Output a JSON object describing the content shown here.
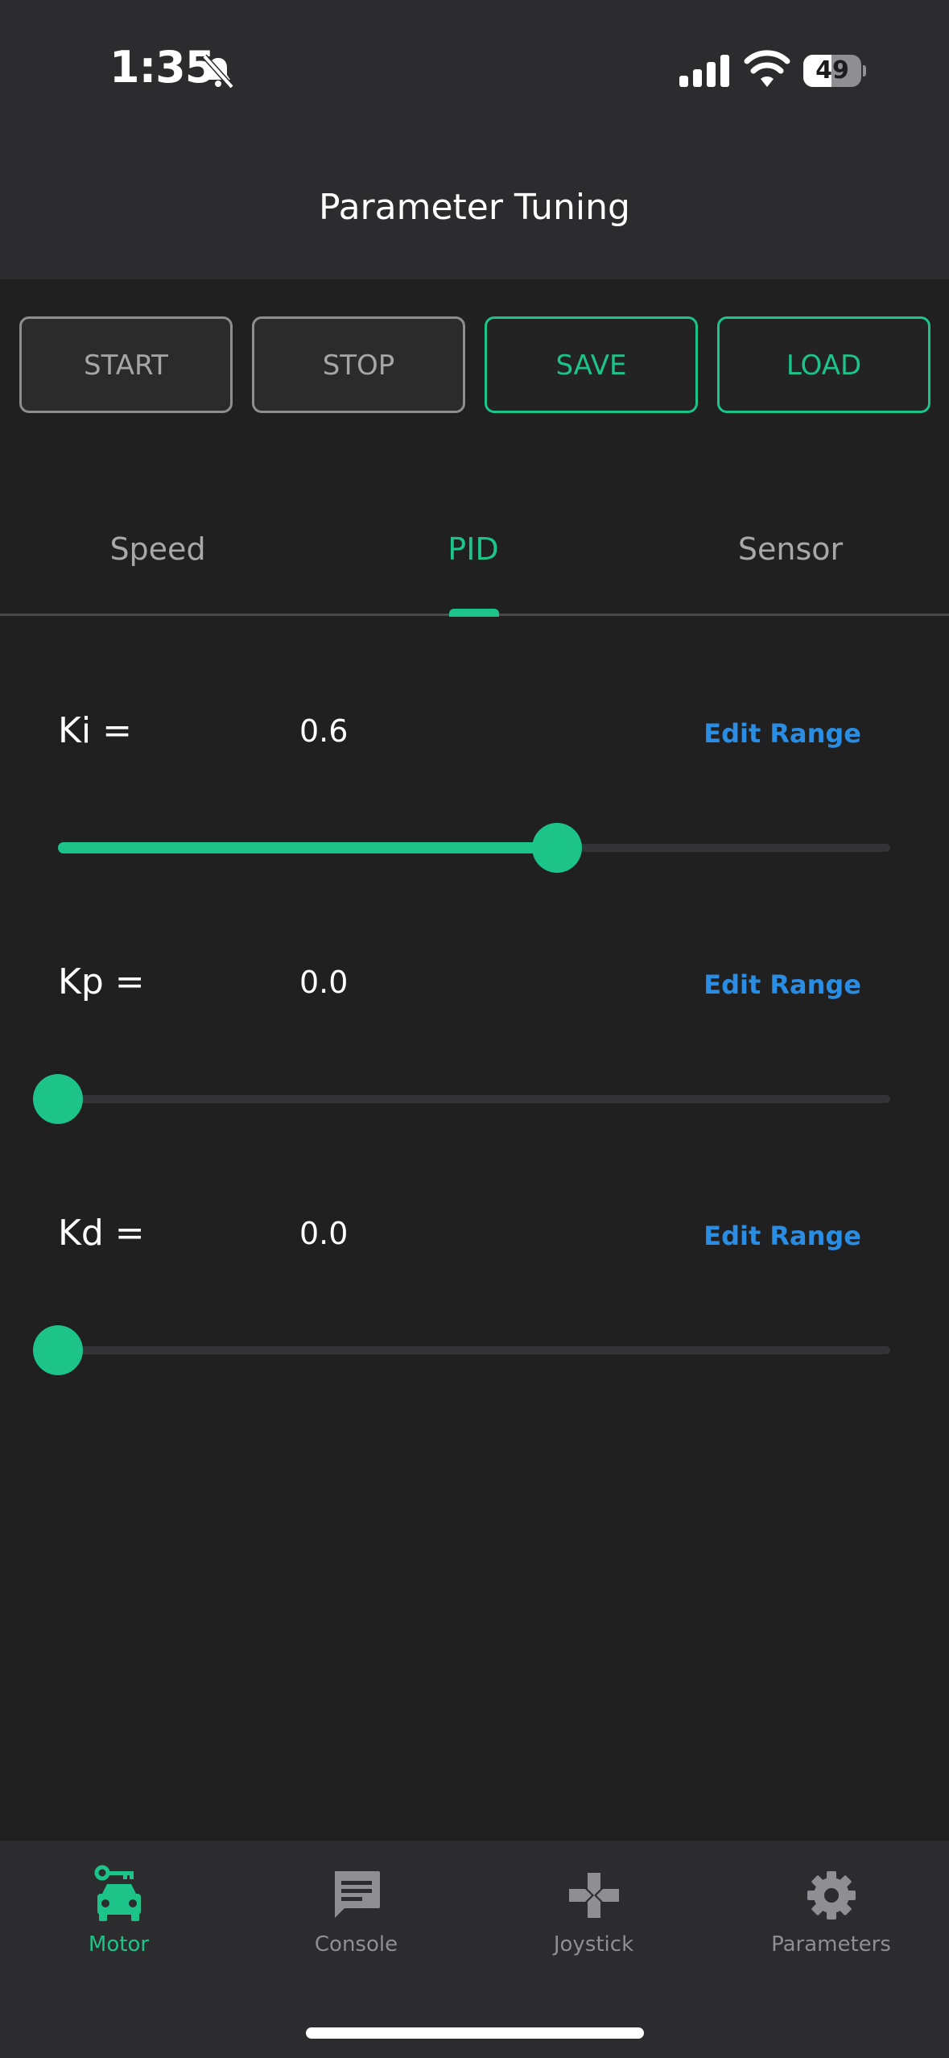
{
  "status_bar": {
    "time": "1:35",
    "battery_level": "49",
    "battery_fraction": 0.49
  },
  "header": {
    "title": "Parameter Tuning"
  },
  "controls": {
    "start_label": "START",
    "stop_label": "STOP",
    "save_label": "SAVE",
    "load_label": "LOAD"
  },
  "tabs": [
    {
      "label": "Speed",
      "active": false
    },
    {
      "label": "PID",
      "active": true
    },
    {
      "label": "Sensor",
      "active": false
    }
  ],
  "params": [
    {
      "label": "Ki =",
      "value": "0.6",
      "edit_label": "Edit Range",
      "level": 0.6
    },
    {
      "label": "Kp =",
      "value": "0.0",
      "edit_label": "Edit Range",
      "level": 0.0
    },
    {
      "label": "Kd =",
      "value": "0.0",
      "edit_label": "Edit Range",
      "level": 0.0
    }
  ],
  "bottom_nav": [
    {
      "label": "Motor",
      "icon": "car-icon",
      "active": true
    },
    {
      "label": "Console",
      "icon": "chat-icon",
      "active": false
    },
    {
      "label": "Joystick",
      "icon": "gamepad-icon",
      "active": false
    },
    {
      "label": "Parameters",
      "icon": "gear-icon",
      "active": false
    }
  ],
  "colors": {
    "accent": "#1dc48a",
    "link": "#2a8de4",
    "background": "#202020",
    "header": "#2c2c2e"
  }
}
